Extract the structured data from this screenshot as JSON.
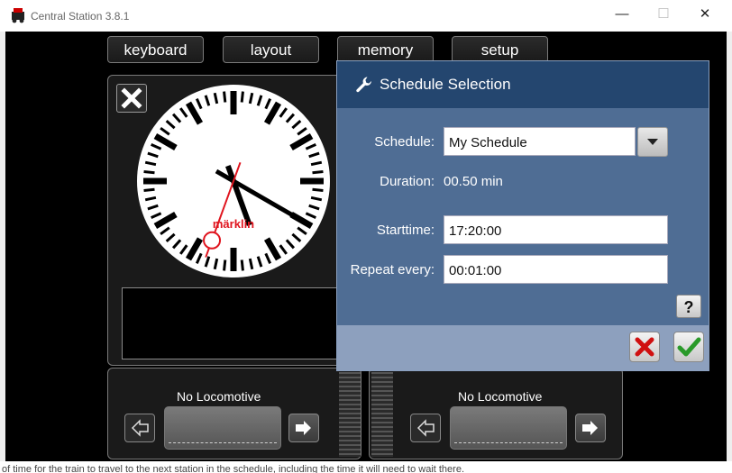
{
  "window": {
    "title": "Central Station 3.8.1",
    "minimize_glyph": "—",
    "maximize_glyph": "☐",
    "close_glyph": "✕"
  },
  "tabs": [
    {
      "label": "keyboard"
    },
    {
      "label": "layout"
    },
    {
      "label": "memory"
    },
    {
      "label": "setup"
    }
  ],
  "clock": {
    "brand": "märklin",
    "time_shown": "17:20"
  },
  "locomotives": [
    {
      "label": "No Locomotive"
    },
    {
      "label": "No Locomotive"
    }
  ],
  "dialog": {
    "title": "Schedule Selection",
    "schedule_label": "Schedule:",
    "schedule_value": "My Schedule",
    "duration_label": "Duration:",
    "duration_value": "00.50 min",
    "starttime_label": "Starttime:",
    "starttime_value": "17:20:00",
    "repeat_label": "Repeat every:",
    "repeat_value": "00:01:00",
    "help_label": "?"
  },
  "background_text": {
    "bottom": "of time for the train to travel to the next station in the schedule, including the time it will need to wait there."
  },
  "colors": {
    "dialog_header": "#24466f",
    "dialog_body": "#4f6d94",
    "dialog_footer": "#8da0be",
    "ok": "#2a9a2a",
    "cancel": "#d01010",
    "clock_hand_red": "#e0141e"
  }
}
